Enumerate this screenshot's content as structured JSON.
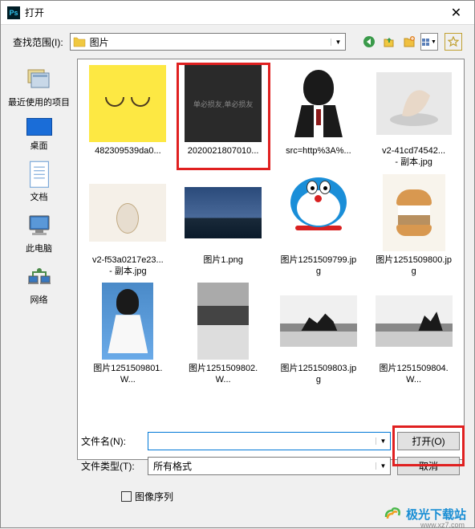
{
  "titlebar": {
    "title": "打开"
  },
  "toolbar": {
    "range_label": "查找范围(I):",
    "folder_name": "图片"
  },
  "sidebar": {
    "recent": "最近使用的项目",
    "desktop": "桌面",
    "docs": "文档",
    "computer": "此电脑",
    "network": "网络"
  },
  "files": [
    {
      "name": "482309539da0..."
    },
    {
      "name": "2020021807010..."
    },
    {
      "name": "src=http%3A%..."
    },
    {
      "name": "v2-41cd74542...\n- 副本.jpg"
    },
    {
      "name": "v2-f53a0217e23...\n- 副本.jpg"
    },
    {
      "name": "图片1.png"
    },
    {
      "name": "图片1251509799.jpg"
    },
    {
      "name": "图片1251509800.jpg"
    },
    {
      "name": "图片1251509801.W..."
    },
    {
      "name": "图片1251509802.W..."
    },
    {
      "name": "图片1251509803.jpg"
    },
    {
      "name": "图片1251509804.W..."
    }
  ],
  "bottom": {
    "filename_label": "文件名(N):",
    "filetype_label": "文件类型(T):",
    "filetype_value": "所有格式",
    "open_btn": "打开(O)",
    "cancel_btn": "取消",
    "sequence_label": "图像序列"
  },
  "watermark": {
    "text": "极光下载站",
    "url": "www.xz7.com"
  }
}
